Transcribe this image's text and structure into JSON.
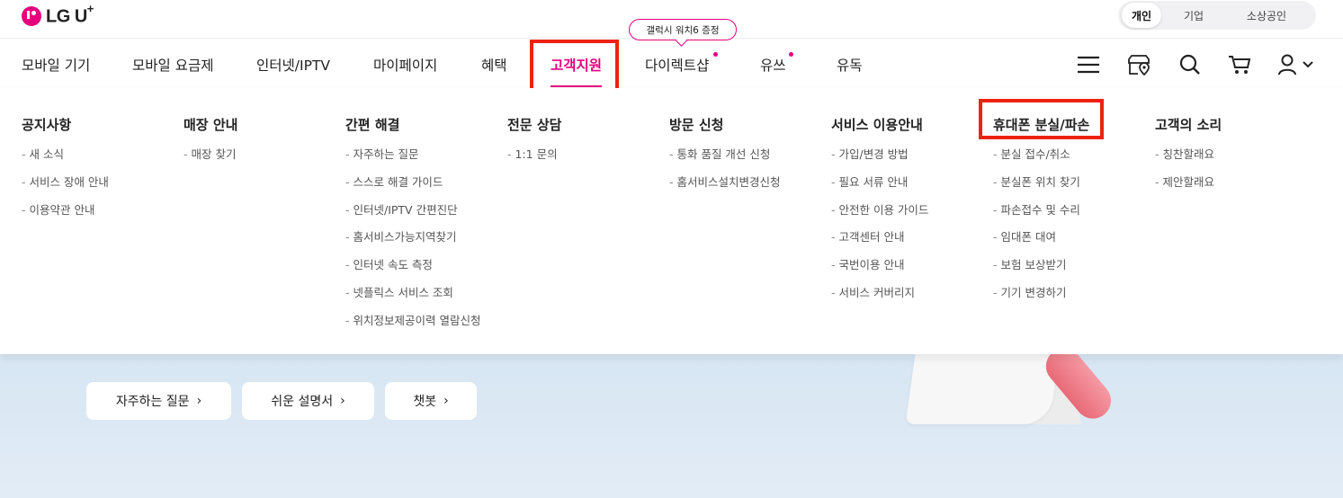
{
  "brand": {
    "logo_text": "LG U",
    "logo_plus": "+"
  },
  "segment": {
    "items": [
      "개인",
      "기업",
      "소상공인"
    ]
  },
  "gnb": {
    "items": [
      "모바일 기기",
      "모바일 요금제",
      "인터넷/IPTV",
      "마이페이지",
      "혜택",
      "고객지원",
      "다이렉트샵",
      "유쓰",
      "유독"
    ],
    "active": "고객지원",
    "promo": "갤럭시 워치6 증정"
  },
  "utility_icons": [
    "menu-icon",
    "store-map-icon",
    "search-icon",
    "cart-icon",
    "user-icon"
  ],
  "mega_menu": {
    "columns": [
      {
        "title": "공지사항",
        "items": [
          "새 소식",
          "서비스 장애 안내",
          "이용약관 안내"
        ]
      },
      {
        "title": "매장 안내",
        "items": [
          "매장 찾기"
        ]
      },
      {
        "title": "간편 해결",
        "items": [
          "자주하는 질문",
          "스스로 해결 가이드",
          "인터넷/IPTV 간편진단",
          "홈서비스가능지역찾기",
          "인터넷 속도 측정",
          "넷플릭스 서비스 조회",
          "위치정보제공이력 열람신청"
        ]
      },
      {
        "title": "전문 상담",
        "items": [
          "1:1 문의"
        ]
      },
      {
        "title": "방문 신청",
        "items": [
          "통화 품질 개선 신청",
          "홈서비스설치변경신청"
        ]
      },
      {
        "title": "서비스 이용안내",
        "items": [
          "가입/변경 방법",
          "필요 서류 안내",
          "안전한 이용 가이드",
          "고객센터 안내",
          "국번이용 안내",
          "서비스 커버리지"
        ]
      },
      {
        "title": "휴대폰 분실/파손",
        "items": [
          "분실 접수/취소",
          "분실폰 위치 찾기",
          "파손접수 및 수리",
          "임대폰 대여",
          "보험 보상받기",
          "기기 변경하기"
        ]
      },
      {
        "title": "고객의 소리",
        "items": [
          "칭찬할래요",
          "제안할래요"
        ]
      }
    ]
  },
  "hero": {
    "buttons": [
      "자주하는 질문",
      "쉬운 설명서",
      "챗봇"
    ]
  },
  "colors": {
    "accent": "#e6007e",
    "highlight_box": "#e21111",
    "hero_bg": "#d7e6f3"
  }
}
